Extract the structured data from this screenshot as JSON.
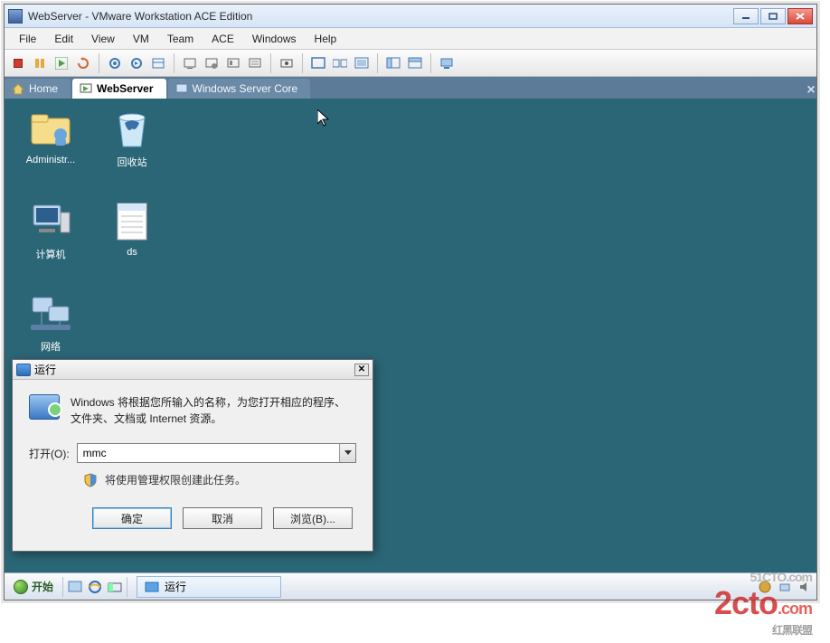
{
  "window": {
    "title": "WebServer - VMware Workstation ACE Edition"
  },
  "menu": {
    "file": "File",
    "edit": "Edit",
    "view": "View",
    "vm": "VM",
    "team": "Team",
    "ace": "ACE",
    "windows": "Windows",
    "help": "Help"
  },
  "tabs": {
    "home": "Home",
    "webserver": "WebServer",
    "wincore": "Windows Server Core"
  },
  "desktop_icons": {
    "administrator": "Administr...",
    "recycle": "回收站",
    "computer": "计算机",
    "ds": "ds",
    "network": "网络"
  },
  "run_dialog": {
    "title": "运行",
    "description": "Windows 将根据您所输入的名称，为您打开相应的程序、文件夹、文档或 Internet 资源。",
    "open_label": "打开(O):",
    "input_value": "mmc",
    "admin_text": "将使用管理权限创建此任务。",
    "ok": "确定",
    "cancel": "取消",
    "browse": "浏览(B)..."
  },
  "taskbar": {
    "start": "开始",
    "running_app": "运行"
  },
  "watermark": {
    "above": "51CTO.com",
    "main": "2cto",
    "suffix": ".com",
    "sub": "红黑联盟"
  }
}
